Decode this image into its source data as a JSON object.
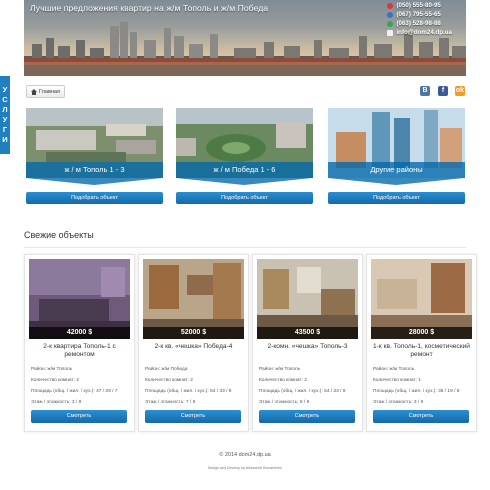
{
  "header": {
    "title": "Лучшие предложения квартир на ж/м Тополь и ж/м Победа",
    "contacts": [
      {
        "icon": "mts-icon",
        "text": "(050) 555-80-95"
      },
      {
        "icon": "kyivstar-icon",
        "text": "(067) 795-55-65"
      },
      {
        "icon": "life-icon",
        "text": "(063) 528-98-88"
      },
      {
        "icon": "mail-icon",
        "text": "info@dom24.dp.ua"
      }
    ]
  },
  "side_tab": {
    "label": [
      "У",
      "С",
      "Л",
      "У",
      "Г",
      "И"
    ]
  },
  "breadcrumb": {
    "home": "Главная"
  },
  "social": {
    "vk": "B",
    "fb": "f",
    "ok": "ok"
  },
  "districts": [
    {
      "label": "ж / м Тополь 1 - 3",
      "button": "Подобрать объект"
    },
    {
      "label": "ж / м Победа 1 - 6",
      "button": "Подобрать объект"
    },
    {
      "label": "Другие районы",
      "button": "Подобрать объект"
    }
  ],
  "listings_section": {
    "title": "Свежие объекты"
  },
  "listings": [
    {
      "price": "42000 $",
      "title": "2-к квартира Тополь-1 с ремонтом",
      "district": "Район: ж/м Тополь",
      "rooms": "Количество комнат: 2",
      "area": "Площадь (общ. / жил. / кух.): 47 / 29 / 7",
      "floor": "Этаж / этажность: 3 / 9",
      "button": "Смотреть"
    },
    {
      "price": "52000 $",
      "title": "2-к кв. «чешка» Победа-4",
      "district": "Район: ж/м Победа",
      "rooms": "Количество комнат: 2",
      "area": "Площадь (общ. / жил. / кух.): 54 / 33 / 9",
      "floor": "Этаж / этажность: 7 / 9",
      "button": "Смотреть"
    },
    {
      "price": "43500 $",
      "title": "2-комн. «чешка» Тополь-3",
      "district": "Район: ж/м Тополь",
      "rooms": "Количество комнат: 2",
      "area": "Площадь (общ. / жил. / кух.): 54 / 33 / 9",
      "floor": "Этаж / этажность: 9 / 9",
      "button": "Смотреть"
    },
    {
      "price": "28000 $",
      "title": "1-к кв. Тополь-1, косметический ремонт",
      "district": "Район: ж/м Тополь",
      "rooms": "Количество комнат: 1",
      "area": "Площадь (общ. / жил. / кух.): 36 / 19 / 8",
      "floor": "Этаж / этажность: 3 / 9",
      "button": "Смотреть"
    }
  ],
  "footer": {
    "copyright": "© 2014 dom24.dp.ua",
    "credit": "Design and Develop by Aleksandr Horoshenko"
  }
}
